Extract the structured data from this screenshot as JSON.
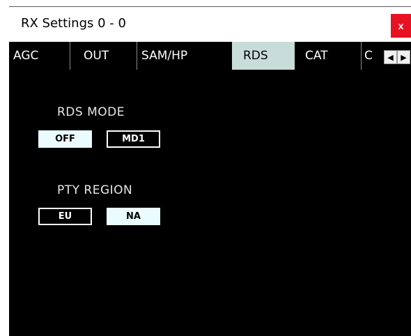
{
  "window": {
    "title": "RX Settings 0 - 0",
    "close_label": "x"
  },
  "tabs": [
    {
      "label": "AGC",
      "active": false
    },
    {
      "label": "OUT",
      "active": false
    },
    {
      "label": "SAM/HP",
      "active": false
    },
    {
      "label": "RDS",
      "active": true
    },
    {
      "label": "CAT",
      "active": false
    },
    {
      "label": "C",
      "active": false
    }
  ],
  "tab_scroll": {
    "left_icon": "◀",
    "right_icon": "▶"
  },
  "rds_mode": {
    "label": "RDS MODE",
    "options": [
      {
        "label": "OFF",
        "selected": true
      },
      {
        "label": "MD1",
        "selected": false
      }
    ]
  },
  "pty_region": {
    "label": "PTY REGION",
    "options": [
      {
        "label": "EU",
        "selected": false
      },
      {
        "label": "NA",
        "selected": true
      }
    ]
  },
  "colors": {
    "background": "#000000",
    "active_tab": "#c8ddd9",
    "selected_button": "#eafcff",
    "close_button": "#e81123"
  }
}
